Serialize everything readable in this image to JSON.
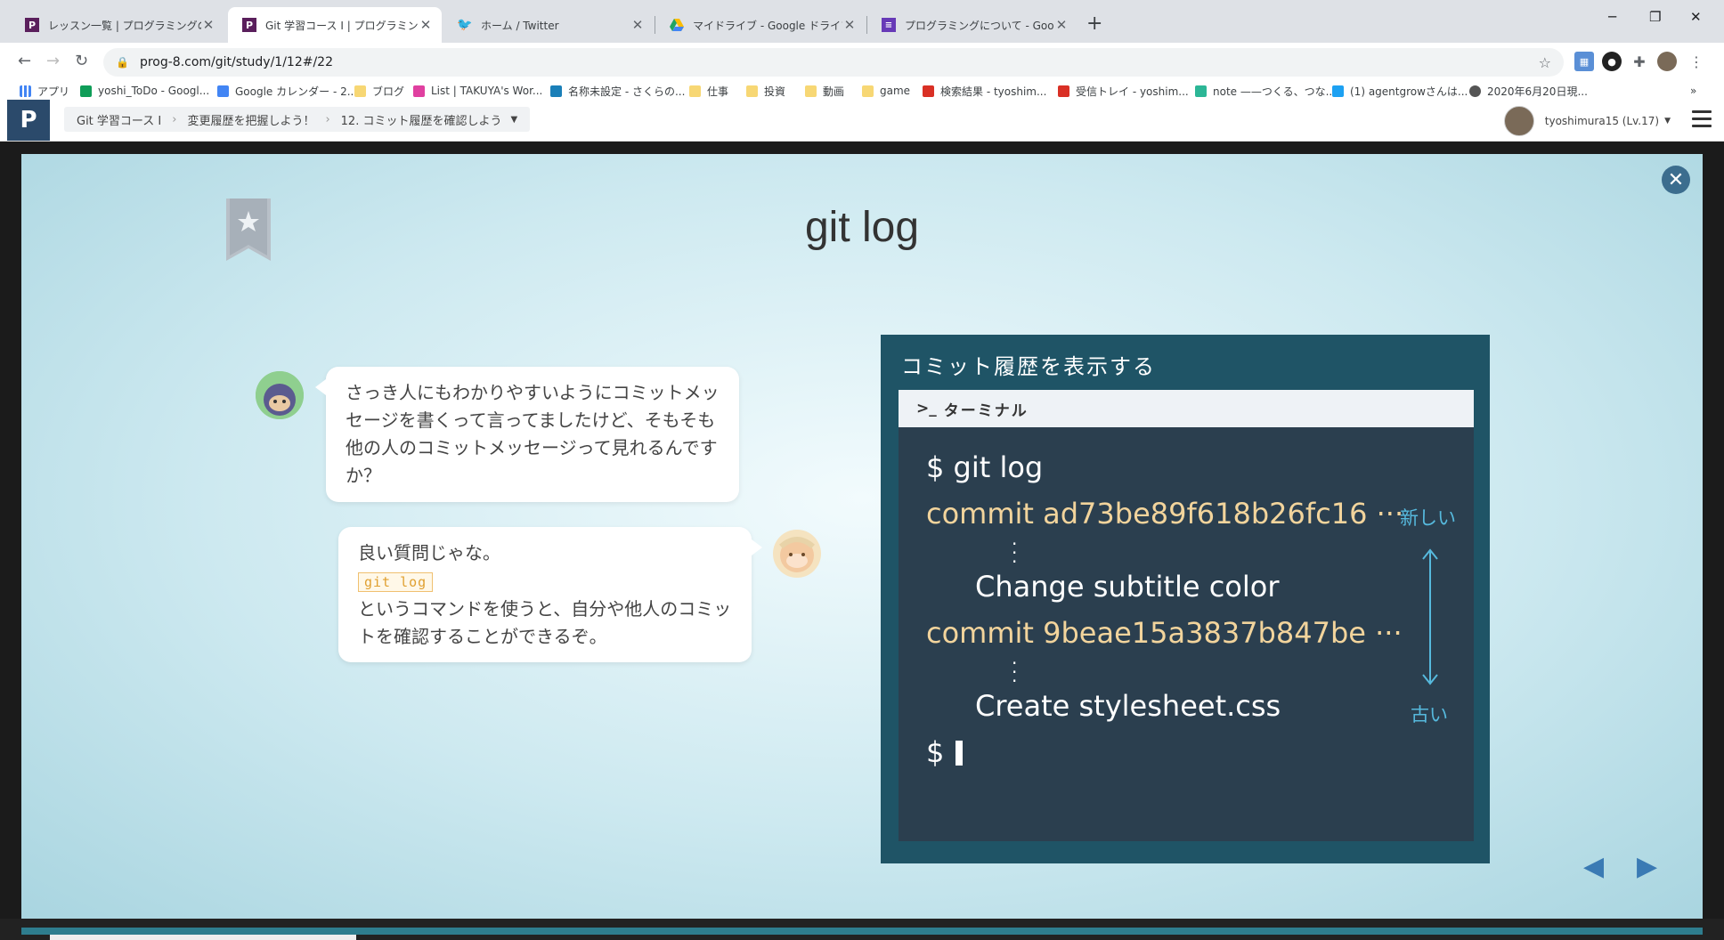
{
  "browser": {
    "tabs": [
      {
        "label": "レッスン一覧 | プログラミングの入門な",
        "icon_color": "#5a1f5c",
        "active": false
      },
      {
        "label": "Git 学習コース I | プログラミングの入門",
        "icon_color": "#5a1f5c",
        "active": true
      },
      {
        "label": "ホーム / Twitter",
        "icon_color": "#1da1f2",
        "active": false
      },
      {
        "label": "マイドライブ - Google ドライブ",
        "icon_color": "#1fa463",
        "active": false
      },
      {
        "label": "プログラミングについて - Google フォー",
        "icon_color": "#673ab7",
        "active": false
      }
    ],
    "url": "prog-8.com/git/study/1/12#/22",
    "bookmarks": [
      {
        "label": "アプリ",
        "color": "#4285f4"
      },
      {
        "label": "yoshi_ToDo - Googl...",
        "color": "#0f9d58"
      },
      {
        "label": "Google カレンダー - 2...",
        "color": "#4285f4"
      },
      {
        "label": "ブログ",
        "color": "#f7d774"
      },
      {
        "label": "List | TAKUYA's Wor...",
        "color": "#e040a0"
      },
      {
        "label": "名称未設定 - さくらの...",
        "color": "#1a7fb8"
      },
      {
        "label": "仕事",
        "color": "#f7d774"
      },
      {
        "label": "投資",
        "color": "#f7d774"
      },
      {
        "label": "動画",
        "color": "#f7d774"
      },
      {
        "label": "game",
        "color": "#f7d774"
      },
      {
        "label": "検索結果 - tyoshim...",
        "color": "#d93025"
      },
      {
        "label": "受信トレイ - yoshim...",
        "color": "#d93025"
      },
      {
        "label": "note ——つくる、つな...",
        "color": "#2cb696"
      },
      {
        "label": "(1) agentgrowさんは...",
        "color": "#1da1f2"
      },
      {
        "label": "2020年6月20日現...",
        "color": "#555555"
      }
    ]
  },
  "site": {
    "logo": "P",
    "breadcrumbs": [
      "Git 学習コース I",
      "変更履歴を把握しよう！",
      "12. コミット履歴を確認しよう"
    ],
    "user_name": "tyoshimura15 (Lv.17)"
  },
  "slide": {
    "title": "git log",
    "dialog1": "さっき人にもわかりやすいようにコミットメッセージを書くって言ってましたけど、そもそも他の人のコミットメッセージって見れるんですか？",
    "dialog2_line1": "良い質問じゃな。",
    "dialog2_code": "git log",
    "dialog2_line2": "というコマンドを使うと、自分や他人のコミットを確認することができるぞ。"
  },
  "terminal": {
    "panel_title": "コミット履歴を表示する",
    "header_label": "ターミナル",
    "command": "$ git log",
    "commit1": "commit ad73be89f618b26fc16 ···",
    "message1": "Change subtitle color",
    "commit2": "commit 9beae15a3837b847be ···",
    "message2": "Create stylesheet.css",
    "prompt": "$",
    "newer_label": "新しい",
    "older_label": "古い"
  }
}
